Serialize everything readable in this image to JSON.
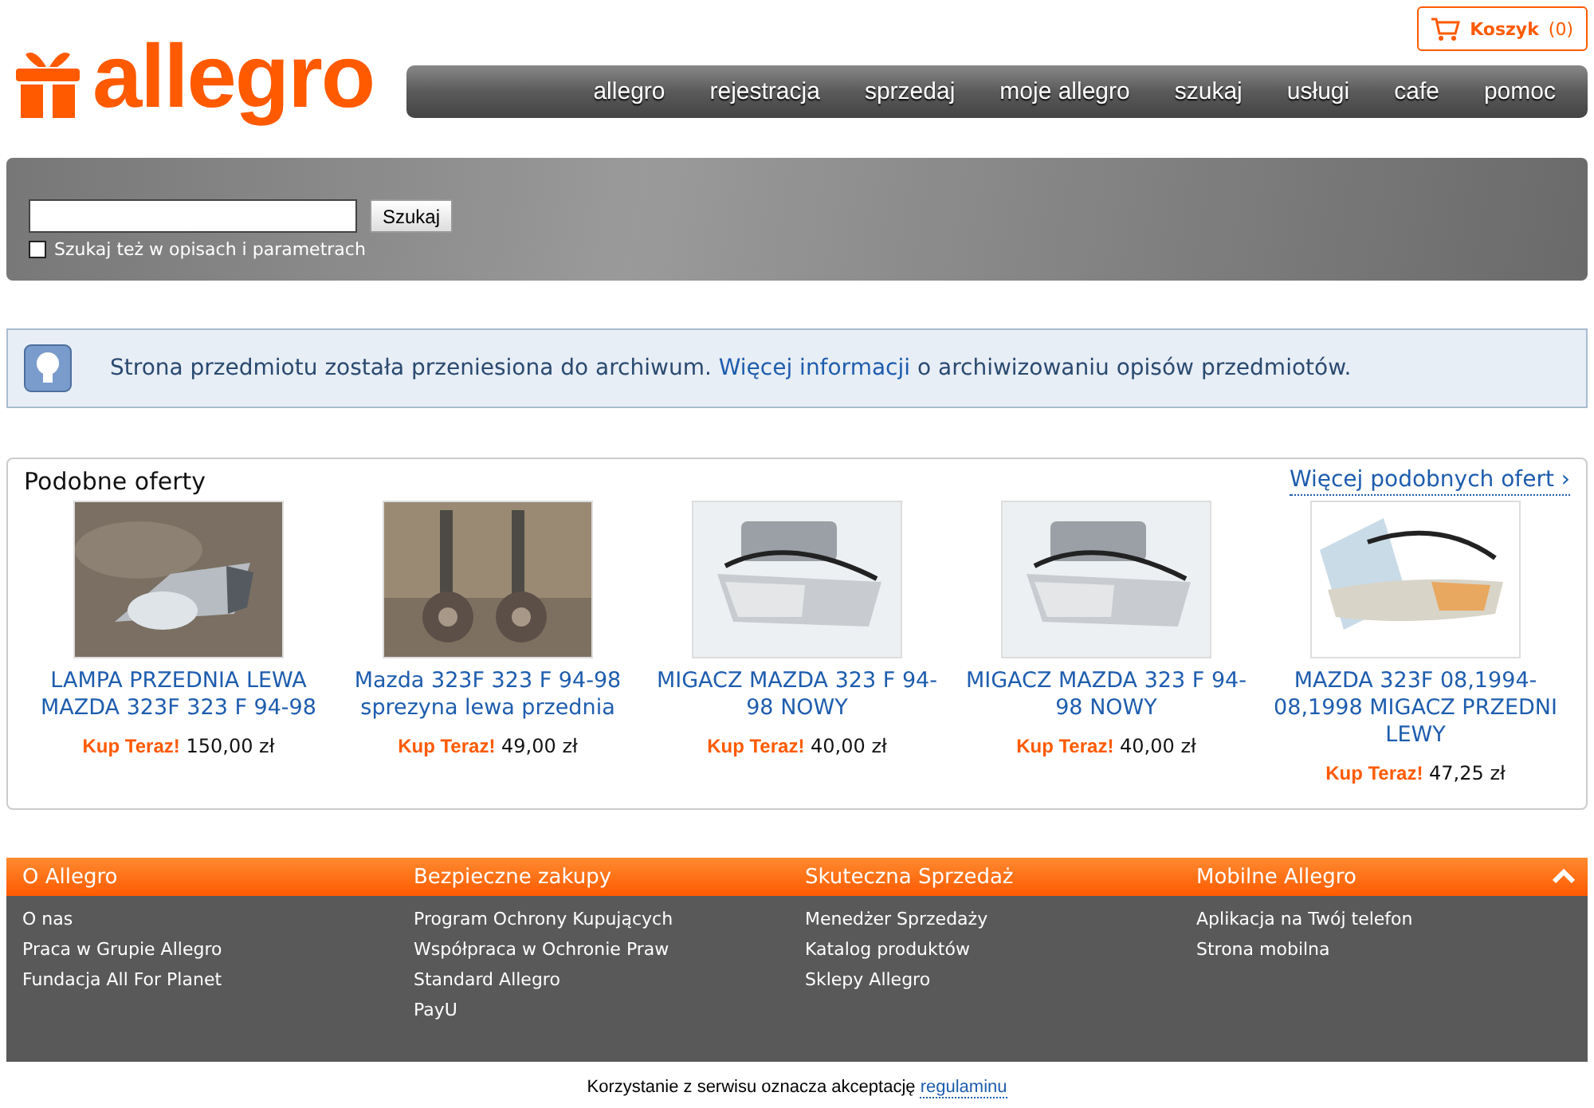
{
  "logo": {
    "text": "allegro"
  },
  "cart": {
    "label": "Koszyk",
    "count": "(0)"
  },
  "nav": [
    "allegro",
    "rejestracja",
    "sprzedaj",
    "moje allegro",
    "szukaj",
    "usługi",
    "cafe",
    "pomoc"
  ],
  "search": {
    "button": "Szukaj",
    "option": {
      "label": "Szukaj też w opisach i parametrach",
      "checked": false
    }
  },
  "notice": {
    "text": "Strona przedmiotu została przeniesiona do archiwum.",
    "link": "Więcej informacji",
    "after": "o archiwizowaniu opisów przedmiotów."
  },
  "similar": {
    "title": "Podobne oferty",
    "more": "Więcej podobnych ofert ›",
    "items": [
      {
        "title": "LAMPA PRZEDNIA LEWA MAZDA 323F 323 F 94-98",
        "buy": "Kup Teraz!",
        "price": "150,00 zł",
        "kind": "picture"
      },
      {
        "title": "Mazda 323F 323 F 94-98 sprezyna lewa przednia",
        "buy": "Kup Teraz!",
        "price": "49,00 zł",
        "kind": "picture"
      },
      {
        "title": "MIGACZ MAZDA 323 F 94-98 NOWY",
        "buy": "Kup Teraz!",
        "price": "40,00 zł",
        "kind": "picture"
      },
      {
        "title": "MIGACZ MAZDA 323 F 94-98 NOWY",
        "buy": "Kup Teraz!",
        "price": "40,00 zł",
        "kind": "picture"
      },
      {
        "title": "MAZDA 323F 08,1994-08,1998 MIGACZ PRZEDNI LEWY",
        "buy": "Kup Teraz!",
        "price": "47,25 zł",
        "kind": "picture"
      }
    ]
  },
  "footer": {
    "columns": [
      {
        "title": "O Allegro",
        "links": [
          "O nas",
          "Praca w Grupie Allegro",
          "Fundacja All For Planet"
        ]
      },
      {
        "title": "Bezpieczne zakupy",
        "links": [
          "Program Ochrony Kupujących",
          "Współpraca w Ochronie Praw",
          "Standard Allegro",
          "PayU"
        ]
      },
      {
        "title": "Skuteczna Sprzedaż",
        "links": [
          "Menedżer Sprzedaży",
          "Katalog produktów",
          "Sklepy Allegro"
        ]
      },
      {
        "title": "Mobilne Allegro",
        "links": [
          "Aplikacja na Twój telefon",
          "Strona mobilna"
        ]
      }
    ]
  },
  "terms": {
    "text": "Korzystanie z serwisu oznacza akceptację",
    "link": "regulaminu"
  }
}
